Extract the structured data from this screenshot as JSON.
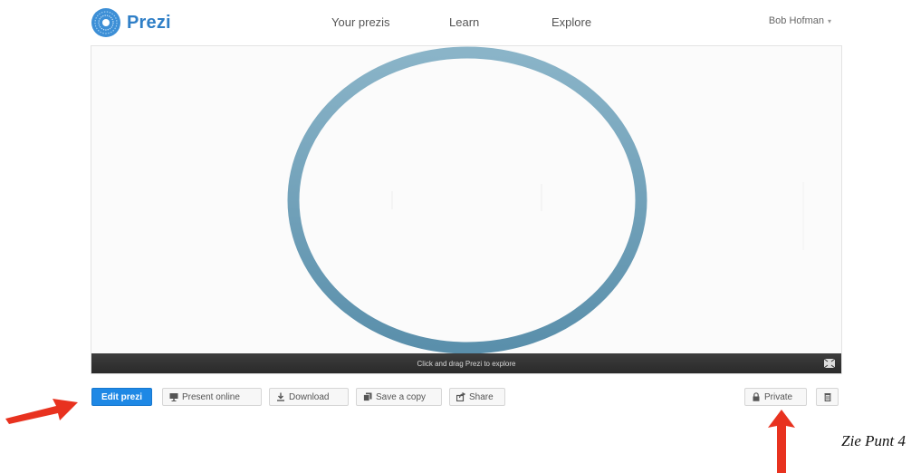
{
  "header": {
    "logo_text": "Prezi",
    "nav": [
      {
        "label": "Your prezis"
      },
      {
        "label": "Learn"
      },
      {
        "label": "Explore"
      }
    ],
    "user_name": "Bob Hofman"
  },
  "stage": {
    "hint": "Click and drag Prezi to explore",
    "ring_color": "#6f9db4"
  },
  "toolbar": {
    "edit_label": "Edit prezi",
    "present_label": "Present online",
    "download_label": "Download",
    "save_copy_label": "Save a copy",
    "share_label": "Share",
    "private_label": "Private"
  },
  "annotation": {
    "text": "Zie Punt 4",
    "arrow_color": "#e8321f"
  },
  "colors": {
    "brand": "#2f7fc7",
    "primary_button": "#1e88e5"
  }
}
